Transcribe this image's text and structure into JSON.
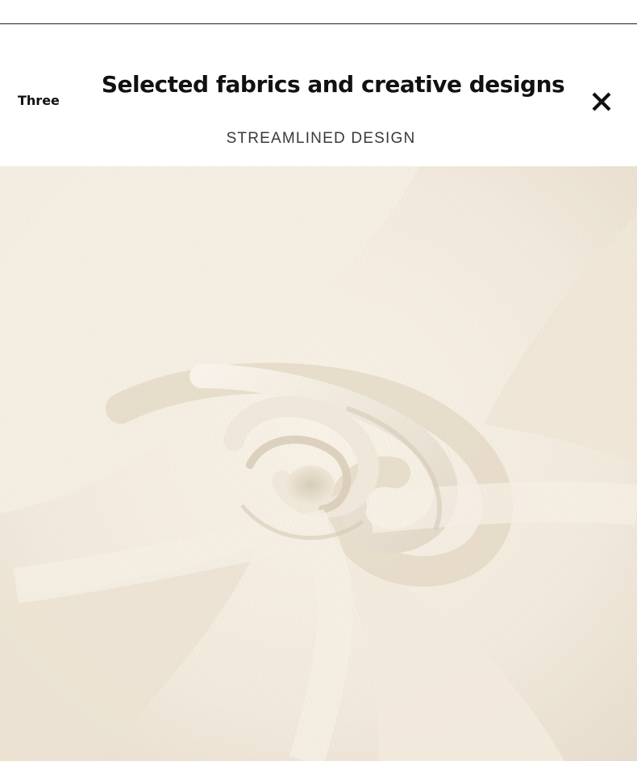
{
  "header": {
    "section_label": "Three",
    "title": "Selected fabrics and creative designs",
    "subtitle": "STREAMLINED DESIGN"
  },
  "icons": {
    "close": "close-icon"
  },
  "colors": {
    "background": "#ffffff",
    "fabric_base": "#f3ece0",
    "fabric_shadow": "#d9cfbf",
    "text": "#111111"
  }
}
